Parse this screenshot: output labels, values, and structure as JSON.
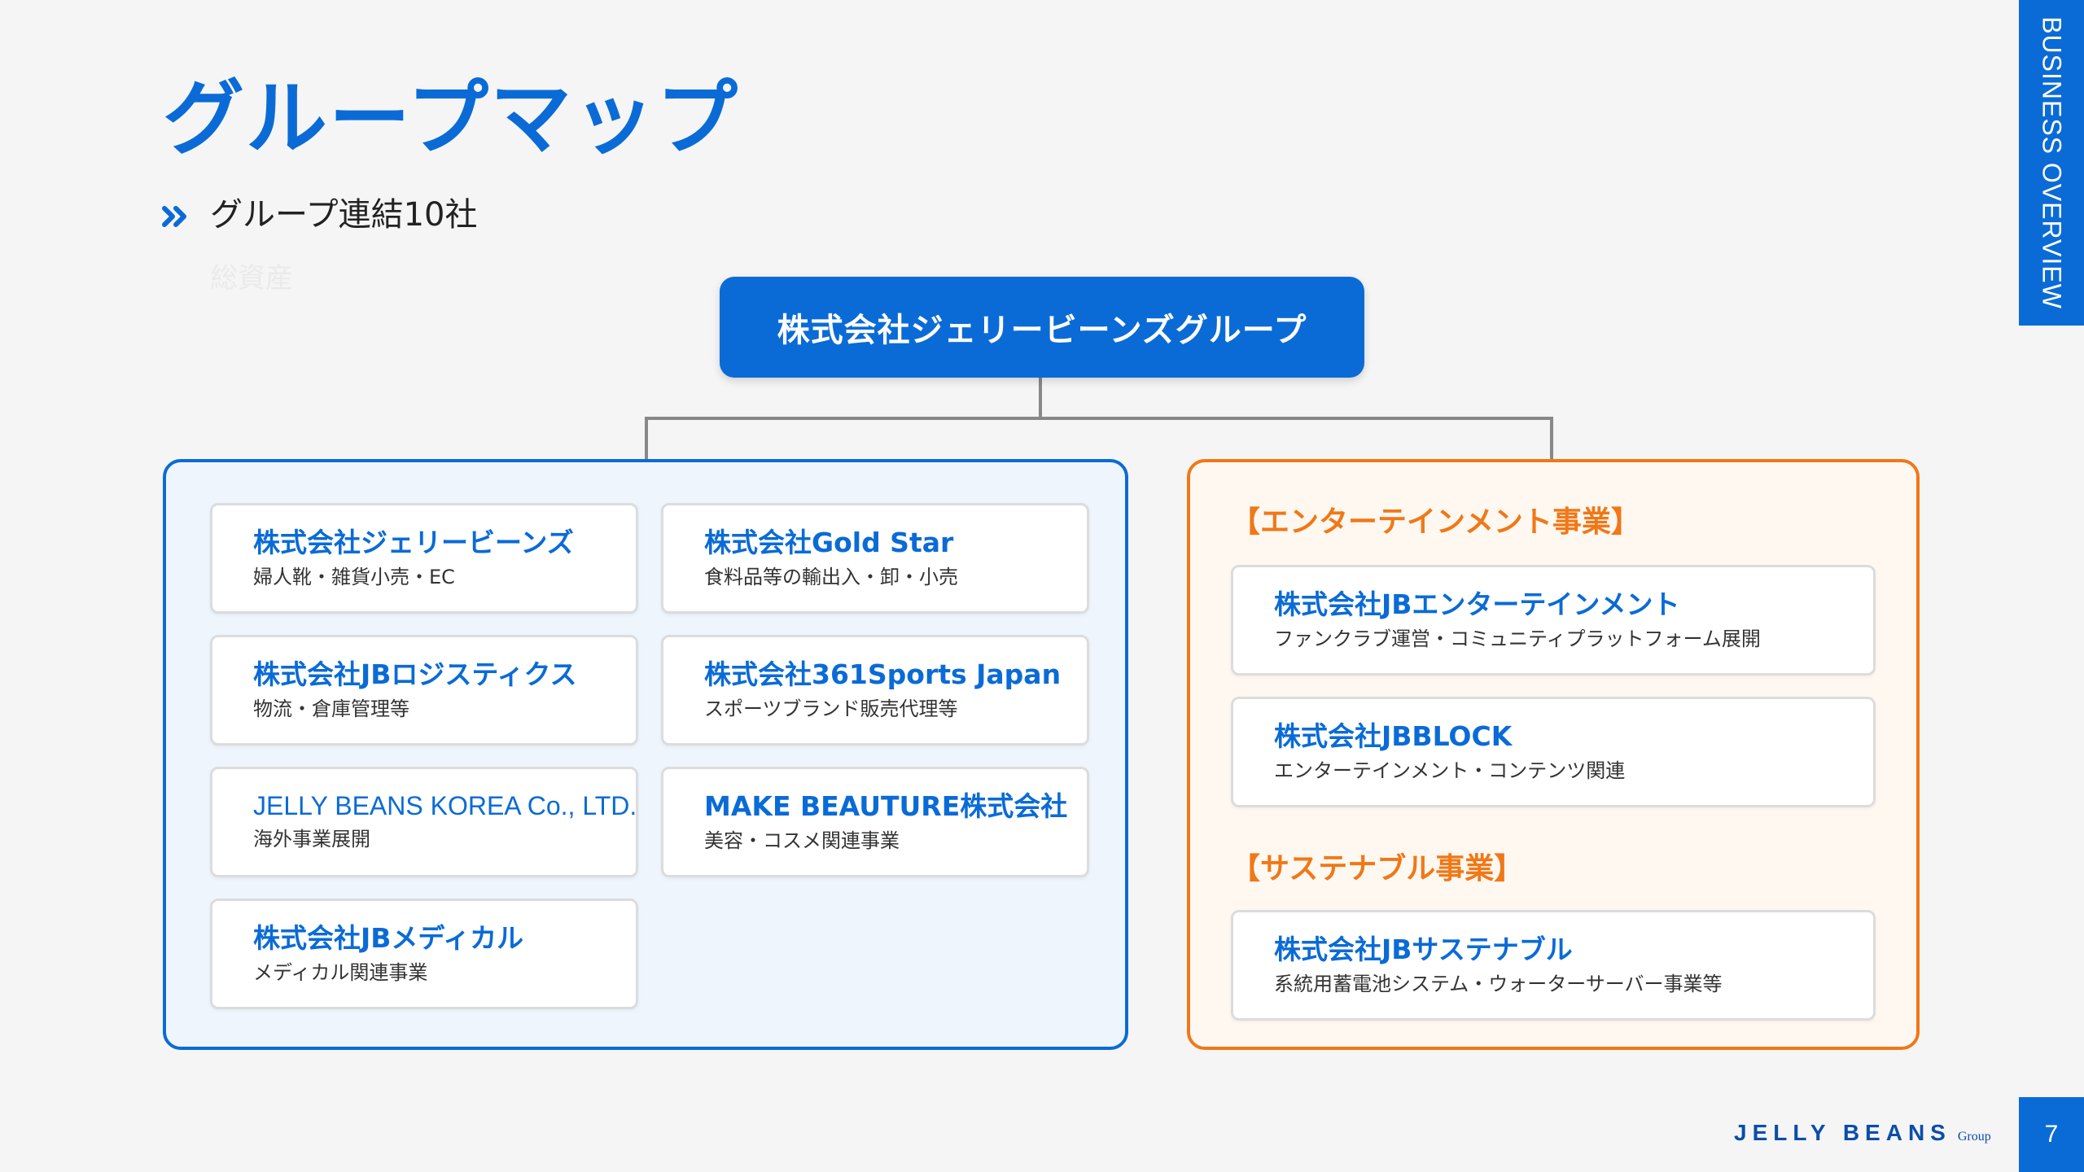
{
  "header": {
    "title": "グループマップ",
    "subtitle": "グループ連結10社",
    "faded_note": "総資産"
  },
  "side_tab": {
    "label": "BUSINESS OVERVIEW"
  },
  "footer": {
    "brand": "JELLY BEANS",
    "brand_sub": "Group",
    "page_number": "7"
  },
  "root": {
    "name": "株式会社ジェリービーンズグループ"
  },
  "left_group": {
    "companies": [
      {
        "name": "株式会社ジェリービーンズ",
        "desc": "婦人靴・雑貨小売・EC"
      },
      {
        "name": "株式会社Gold Star",
        "desc": "食料品等の輸出入・卸・小売"
      },
      {
        "name": "株式会社JBロジスティクス",
        "desc": "物流・倉庫管理等"
      },
      {
        "name": "株式会社361Sports Japan",
        "desc": "スポーツブランド販売代理等"
      },
      {
        "name": "JELLY BEANS KOREA Co., LTD.",
        "desc": "海外事業展開"
      },
      {
        "name": "MAKE BEAUTURE株式会社",
        "desc": "美容・コスメ関連事業"
      },
      {
        "name": "株式会社JBメディカル",
        "desc": "メディカル関連事業"
      }
    ]
  },
  "right_group": {
    "entertainment_heading": "【エンターテインメント事業】",
    "entertainment": [
      {
        "name": "株式会社JBエンターテインメント",
        "desc": "ファンクラブ運営・コミュニティプラットフォーム展開"
      },
      {
        "name": "株式会社JBBLOCK",
        "desc": "エンターテインメント・コンテンツ関連"
      }
    ],
    "sustainable_heading": "【サステナブル事業】",
    "sustainable": [
      {
        "name": "株式会社JBサステナブル",
        "desc": "系統用蓄電池システム・ウォーターサーバー事業等"
      }
    ]
  },
  "colors": {
    "primary": "#0a6bd6",
    "accent": "#f07818",
    "connector": "#888888"
  }
}
